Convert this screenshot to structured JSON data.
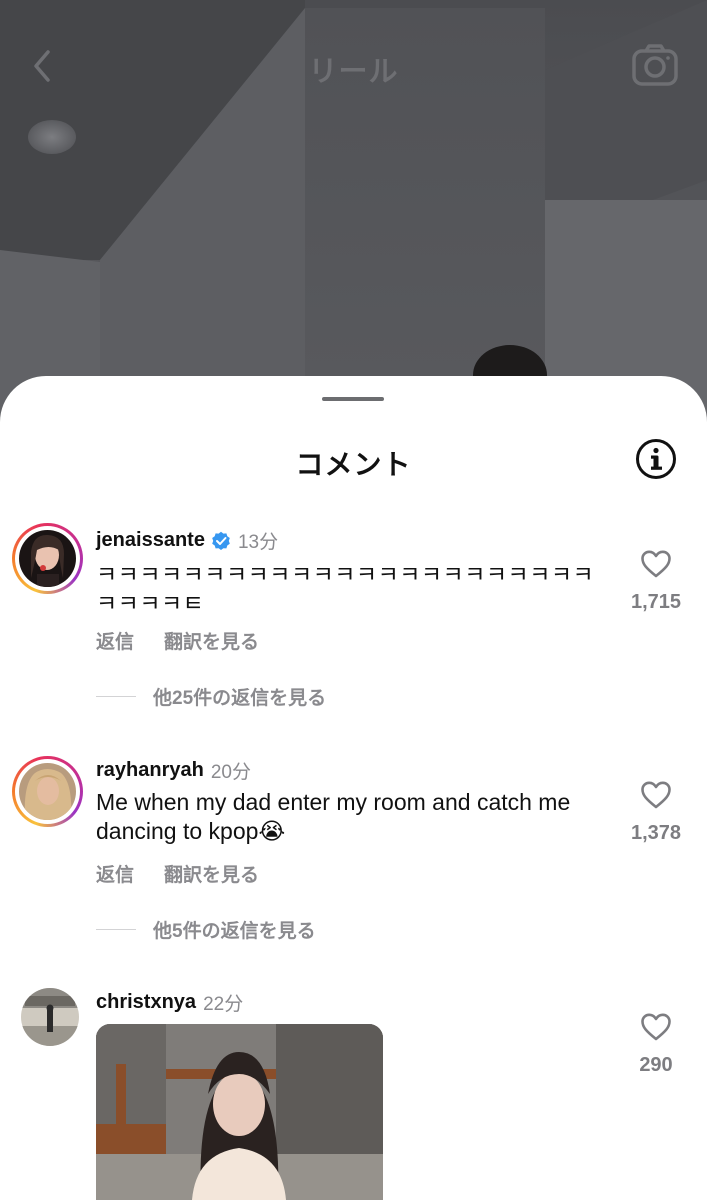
{
  "topbar": {
    "title": "リール",
    "back_icon": "chevron-left-icon",
    "camera_icon": "camera-icon"
  },
  "sheet": {
    "title": "コメント",
    "info_icon": "info-icon"
  },
  "comments": [
    {
      "username": "jenaissante",
      "verified": true,
      "time": "13分",
      "text": "ㅋㅋㅋㅋㅋㅋㅋㅋㅋㅋㅋㅋㅋㅋㅋㅋㅋㅋㅋㅋㅋㅋㅋㅋㅋㅋㅋㅌ",
      "reply_label": "返信",
      "translate_label": "翻訳を見る",
      "view_replies": "他25件の返信を見る",
      "likes": "1,715"
    },
    {
      "username": "rayhanryah",
      "verified": false,
      "time": "20分",
      "text": "Me when my dad enter my room and catch me dancing to kpop😭",
      "reply_label": "返信",
      "translate_label": "翻訳を見る",
      "view_replies": "他5件の返信を見る",
      "likes": "1,378"
    },
    {
      "username": "christxnya",
      "verified": false,
      "time": "22分",
      "likes": "290"
    }
  ],
  "colors": {
    "accent_blue": "#3797f0",
    "muted_text": "#8a8a8e"
  }
}
